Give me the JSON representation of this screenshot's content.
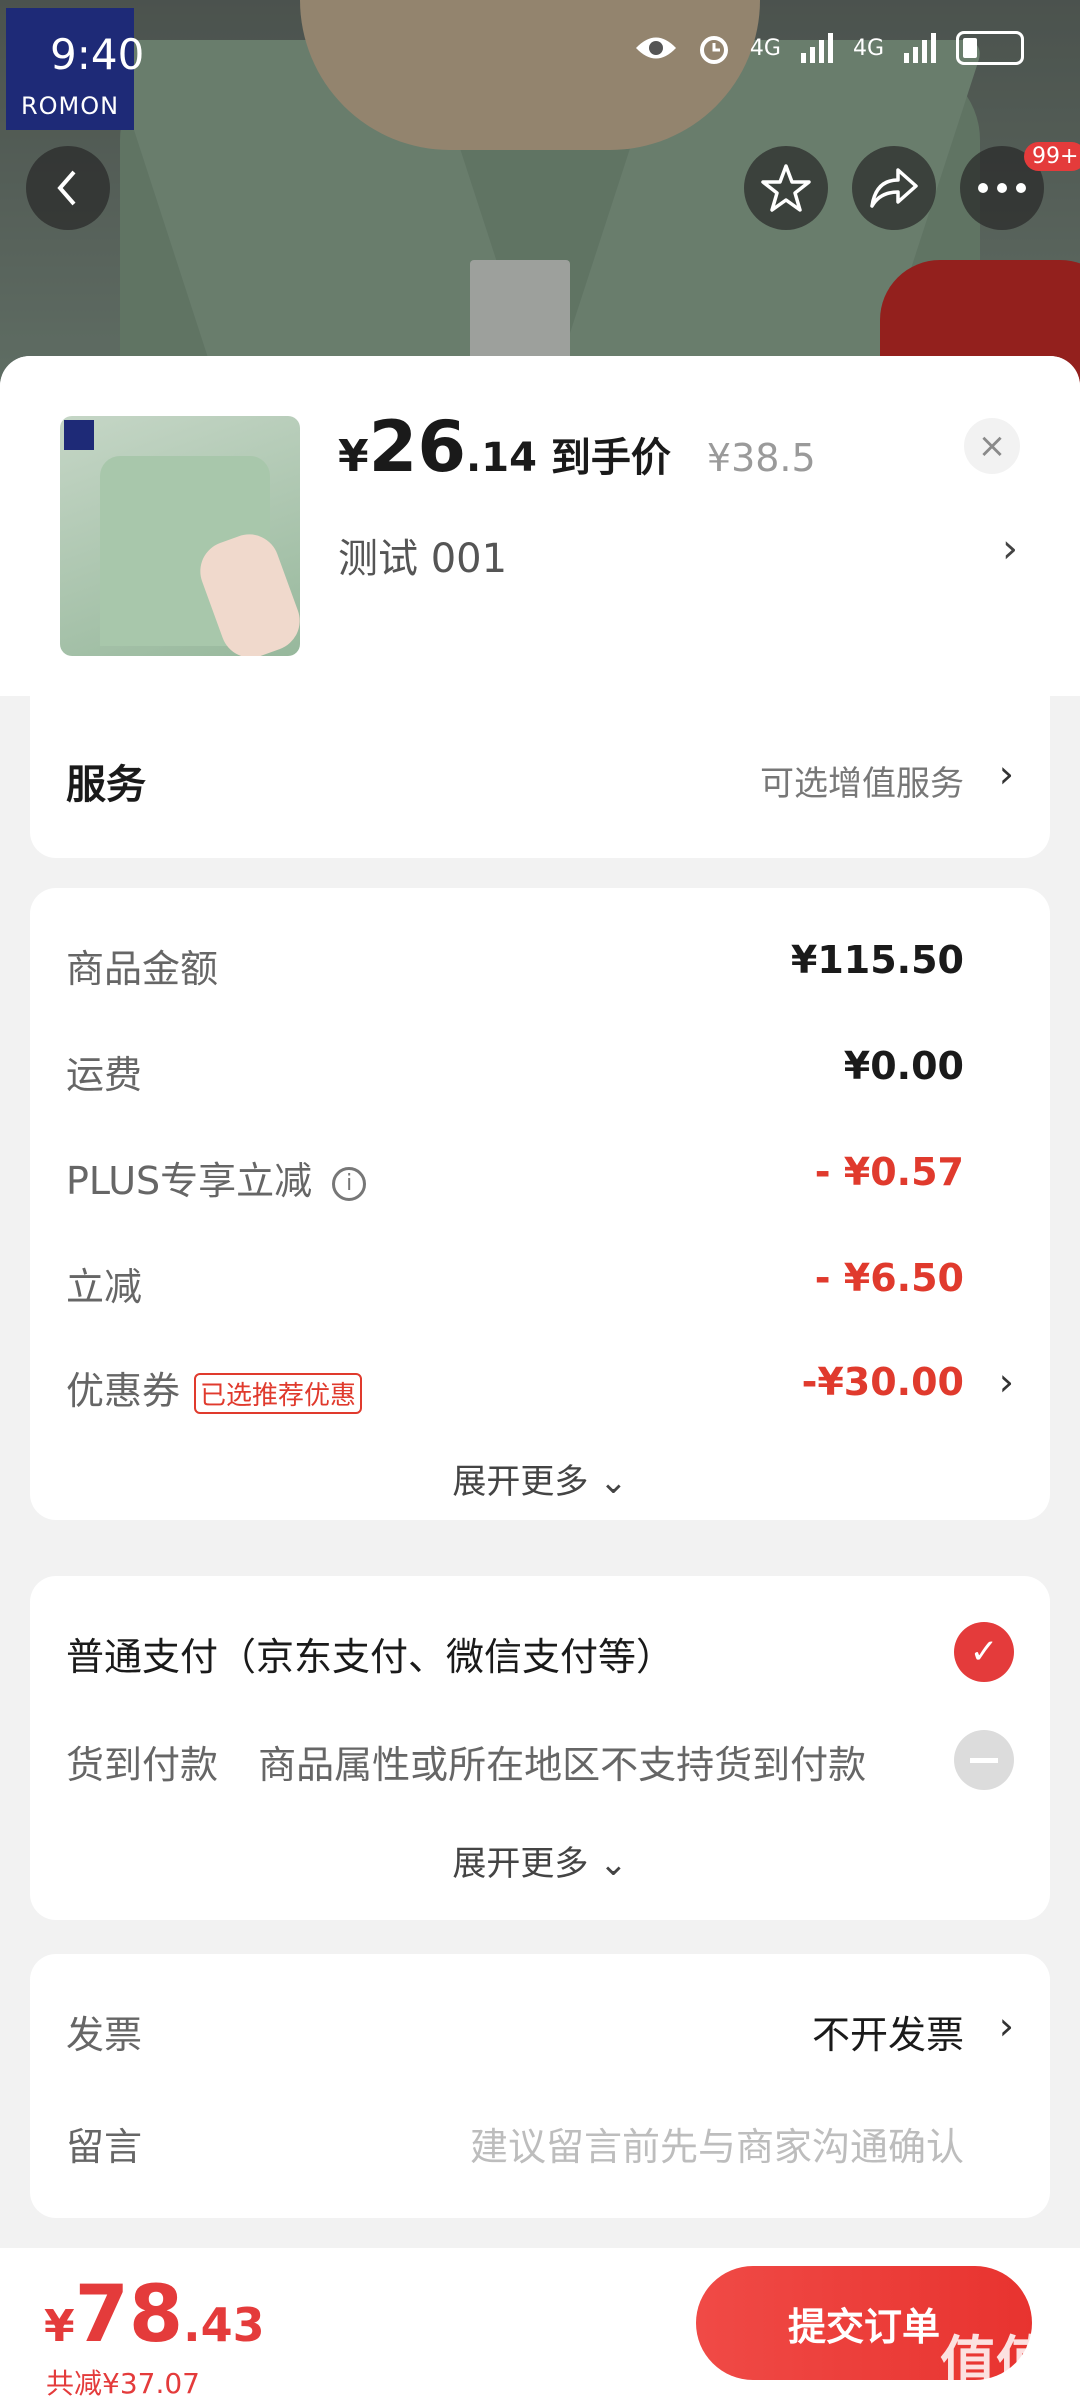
{
  "status_bar": {
    "time": "9:40",
    "network_1": "4G",
    "network_2": "4G"
  },
  "background": {
    "brand_logo_text": "ROMON"
  },
  "nav": {
    "more_badge": "99+"
  },
  "product": {
    "price_yen": "¥",
    "price_int": "26",
    "price_dec": ".14",
    "price_label": "到手价",
    "original_price": "¥38.5",
    "spec": "测试  001",
    "close": "×"
  },
  "service": {
    "title": "服务",
    "value": "可选增值服务"
  },
  "amounts": {
    "goods_label": "商品金额",
    "goods_value": "¥115.50",
    "shipping_label": "运费",
    "shipping_value": "¥0.00",
    "plus_label": "PLUS专享立减",
    "plus_value": "- ¥0.57",
    "direct_label": "立减",
    "direct_value": "- ¥6.50",
    "coupon_label": "优惠券",
    "coupon_tag": "已选推荐优惠",
    "coupon_value": "-¥30.00",
    "expand_more": "展开更多"
  },
  "payment": {
    "normal_label": "普通支付（京东支付、微信支付等）",
    "cod_label": "货到付款",
    "cod_note": "商品属性或所在地区不支持货到付款",
    "expand_more": "展开更多"
  },
  "extra": {
    "invoice_label": "发票",
    "invoice_value": "不开发票",
    "note_label": "留言",
    "note_placeholder": "建议留言前先与商家沟通确认"
  },
  "bottom": {
    "total_yen": "¥",
    "total_int": "78",
    "total_dec": ".43",
    "saved": "共减¥37.07",
    "submit": "提交订单"
  },
  "watermark": "值值值",
  "colors": {
    "accent": "#e43b3b",
    "discount": "#e03a2d"
  }
}
